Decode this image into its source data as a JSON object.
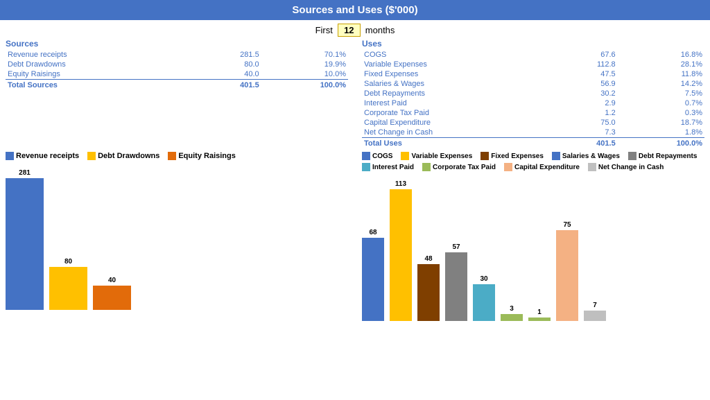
{
  "header": {
    "title": "Sources and Uses ($'000)",
    "months_label_pre": "First",
    "months_value": "12",
    "months_label_post": "months"
  },
  "sources": {
    "section_title": "Sources",
    "rows": [
      {
        "label": "Revenue receipts",
        "value": "281.5",
        "pct": "70.1%"
      },
      {
        "label": "Debt Drawdowns",
        "value": "80.0",
        "pct": "19.9%"
      },
      {
        "label": "Equity Raisings",
        "value": "40.0",
        "pct": "10.0%"
      }
    ],
    "total": {
      "label": "Total Sources",
      "value": "401.5",
      "pct": "100.0%"
    }
  },
  "uses": {
    "section_title": "Uses",
    "rows": [
      {
        "label": "COGS",
        "value": "67.6",
        "pct": "16.8%"
      },
      {
        "label": "Variable Expenses",
        "value": "112.8",
        "pct": "28.1%"
      },
      {
        "label": "Fixed Expenses",
        "value": "47.5",
        "pct": "11.8%"
      },
      {
        "label": "Salaries & Wages",
        "value": "56.9",
        "pct": "14.2%"
      },
      {
        "label": "Debt Repayments",
        "value": "30.2",
        "pct": "7.5%"
      },
      {
        "label": "Interest Paid",
        "value": "2.9",
        "pct": "0.7%"
      },
      {
        "label": "Corporate Tax Paid",
        "value": "1.2",
        "pct": "0.3%"
      },
      {
        "label": "Capital Expenditure",
        "value": "75.0",
        "pct": "18.7%"
      },
      {
        "label": "Net Change in Cash",
        "value": "7.3",
        "pct": "1.8%"
      }
    ],
    "total": {
      "label": "Total Uses",
      "value": "401.5",
      "pct": "100.0%"
    }
  },
  "sources_chart": {
    "legend": [
      {
        "label": "Revenue receipts",
        "color": "#4472C4"
      },
      {
        "label": "Debt Drawdowns",
        "color": "#FFC000"
      },
      {
        "label": "Equity Raisings",
        "color": "#E26B0A"
      }
    ],
    "bars": [
      {
        "label": "281",
        "value": 281,
        "color": "#4472C4",
        "height": 190
      },
      {
        "label": "80",
        "value": 80,
        "color": "#FFC000",
        "height": 62
      },
      {
        "label": "40",
        "value": 40,
        "color": "#E26B0A",
        "height": 35
      }
    ]
  },
  "uses_chart": {
    "legend": [
      {
        "label": "COGS",
        "color": "#4472C4"
      },
      {
        "label": "Variable Expenses",
        "color": "#FFC000"
      },
      {
        "label": "Fixed Expenses",
        "color": "#7F3F00"
      },
      {
        "label": "Salaries & Wages",
        "color": "#4472C4"
      },
      {
        "label": "Debt Repayments",
        "color": "#808080"
      },
      {
        "label": "Interest Paid",
        "color": "#4BACC6"
      },
      {
        "label": "Corporate Tax Paid",
        "color": "#9BBB59"
      },
      {
        "label": "Capital Expenditure",
        "color": "#F4B183"
      },
      {
        "label": "Net Change in Cash",
        "color": "#BFBFBF"
      }
    ],
    "bars": [
      {
        "label": "68",
        "value": 68,
        "color": "#4472C4",
        "height": 120
      },
      {
        "label": "113",
        "value": 113,
        "color": "#FFC000",
        "height": 190
      },
      {
        "label": "48",
        "value": 48,
        "color": "#8B4513",
        "height": 82
      },
      {
        "label": "57",
        "value": 57,
        "color": "#808080",
        "height": 99
      },
      {
        "label": "30",
        "value": 30,
        "color": "#4BACC6",
        "height": 53
      },
      {
        "label": "3",
        "value": 3,
        "color": "#9BBB59",
        "height": 10
      },
      {
        "label": "1",
        "value": 1,
        "color": "#9BBB59",
        "height": 5
      },
      {
        "label": "75",
        "value": 75,
        "color": "#F4B183",
        "height": 131
      },
      {
        "label": "7",
        "value": 7,
        "color": "#BFBFBF",
        "height": 15
      }
    ]
  }
}
